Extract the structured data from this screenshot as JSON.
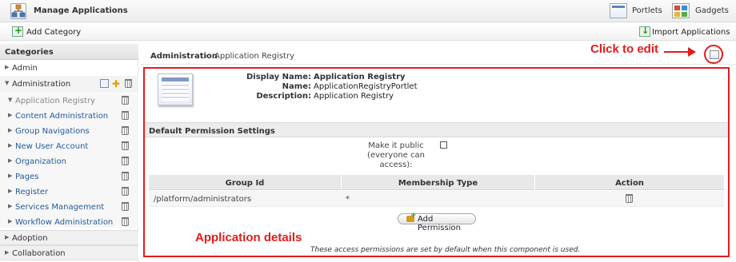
{
  "header": {
    "title": "Manage Applications",
    "portlets_label": "Portlets",
    "gadgets_label": "Gadgets"
  },
  "toolbar": {
    "add_category_label": "Add Category",
    "import_applications_label": "Import Applications"
  },
  "sidebar": {
    "header": "Categories",
    "categories": [
      {
        "label": "Admin",
        "expanded": false
      },
      {
        "label": "Administration",
        "expanded": true
      },
      {
        "label": "Adoption",
        "expanded": false
      },
      {
        "label": "Collaboration",
        "expanded": false
      }
    ],
    "administration_items": [
      {
        "label": "Application Registry",
        "active": true
      },
      {
        "label": "Content Administration"
      },
      {
        "label": "Group Navigations"
      },
      {
        "label": "New User Account"
      },
      {
        "label": "Organization"
      },
      {
        "label": "Pages"
      },
      {
        "label": "Register"
      },
      {
        "label": "Services Management"
      },
      {
        "label": "Workflow Administration"
      }
    ]
  },
  "breadcrumb": {
    "root": "Administration",
    "separator": "›",
    "current": "Application Registry"
  },
  "annotations": {
    "click_to_edit": "Click to edit",
    "application_details": "Application details",
    "color": "#e31b1b"
  },
  "application": {
    "display_name_label": "Display Name:",
    "display_name": "Application Registry",
    "name_label": "Name:",
    "name": "ApplicationRegistryPortlet",
    "description_label": "Description:",
    "description": "Application Registry"
  },
  "permissions": {
    "section_title": "Default Permission Settings",
    "make_public_label": "Make it public (everyone can access):",
    "make_public_checked": false,
    "columns": [
      "Group Id",
      "Membership Type",
      "Action"
    ],
    "rows": [
      {
        "group_id": "/platform/administrators",
        "membership_type": "*"
      }
    ],
    "add_permission_label": "Add Permission",
    "footnote": "These access permissions are set by default when this component is used."
  }
}
